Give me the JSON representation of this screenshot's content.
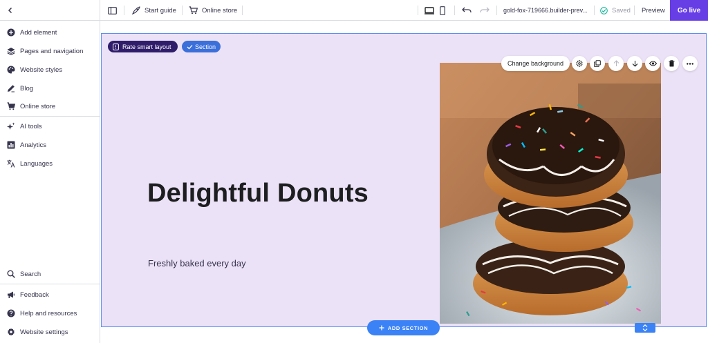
{
  "topbar": {
    "back_icon": "chevron-left-icon",
    "start_guide": "Start guide",
    "online_store": "Online store",
    "url": "gold-fox-719666.builder-prev...",
    "saved": "Saved",
    "preview": "Preview",
    "go_live": "Go live",
    "accent": "#673de6"
  },
  "sidebar": {
    "items_top": [
      {
        "label": "Add element",
        "icon": "plus-circle-icon"
      },
      {
        "label": "Pages and navigation",
        "icon": "layers-icon"
      },
      {
        "label": "Website styles",
        "icon": "palette-icon"
      },
      {
        "label": "Blog",
        "icon": "pen-icon"
      },
      {
        "label": "Online store",
        "icon": "cart-icon"
      }
    ],
    "items_mid": [
      {
        "label": "AI tools",
        "icon": "sparkle-icon"
      },
      {
        "label": "Analytics",
        "icon": "chart-icon"
      },
      {
        "label": "Languages",
        "icon": "translate-icon"
      }
    ],
    "items_bottom": [
      {
        "label": "Search",
        "icon": "search-icon"
      },
      {
        "label": "Feedback",
        "icon": "megaphone-icon"
      },
      {
        "label": "Help and resources",
        "icon": "help-icon"
      },
      {
        "label": "Website settings",
        "icon": "gear-icon"
      }
    ]
  },
  "section": {
    "rate_label": "Rate smart layout",
    "section_label": "Section",
    "headline": "Delightful Donuts",
    "subline": "Freshly baked every day",
    "change_background": "Change background",
    "background": "#ece2f7",
    "add_section": "ADD SECTION"
  }
}
